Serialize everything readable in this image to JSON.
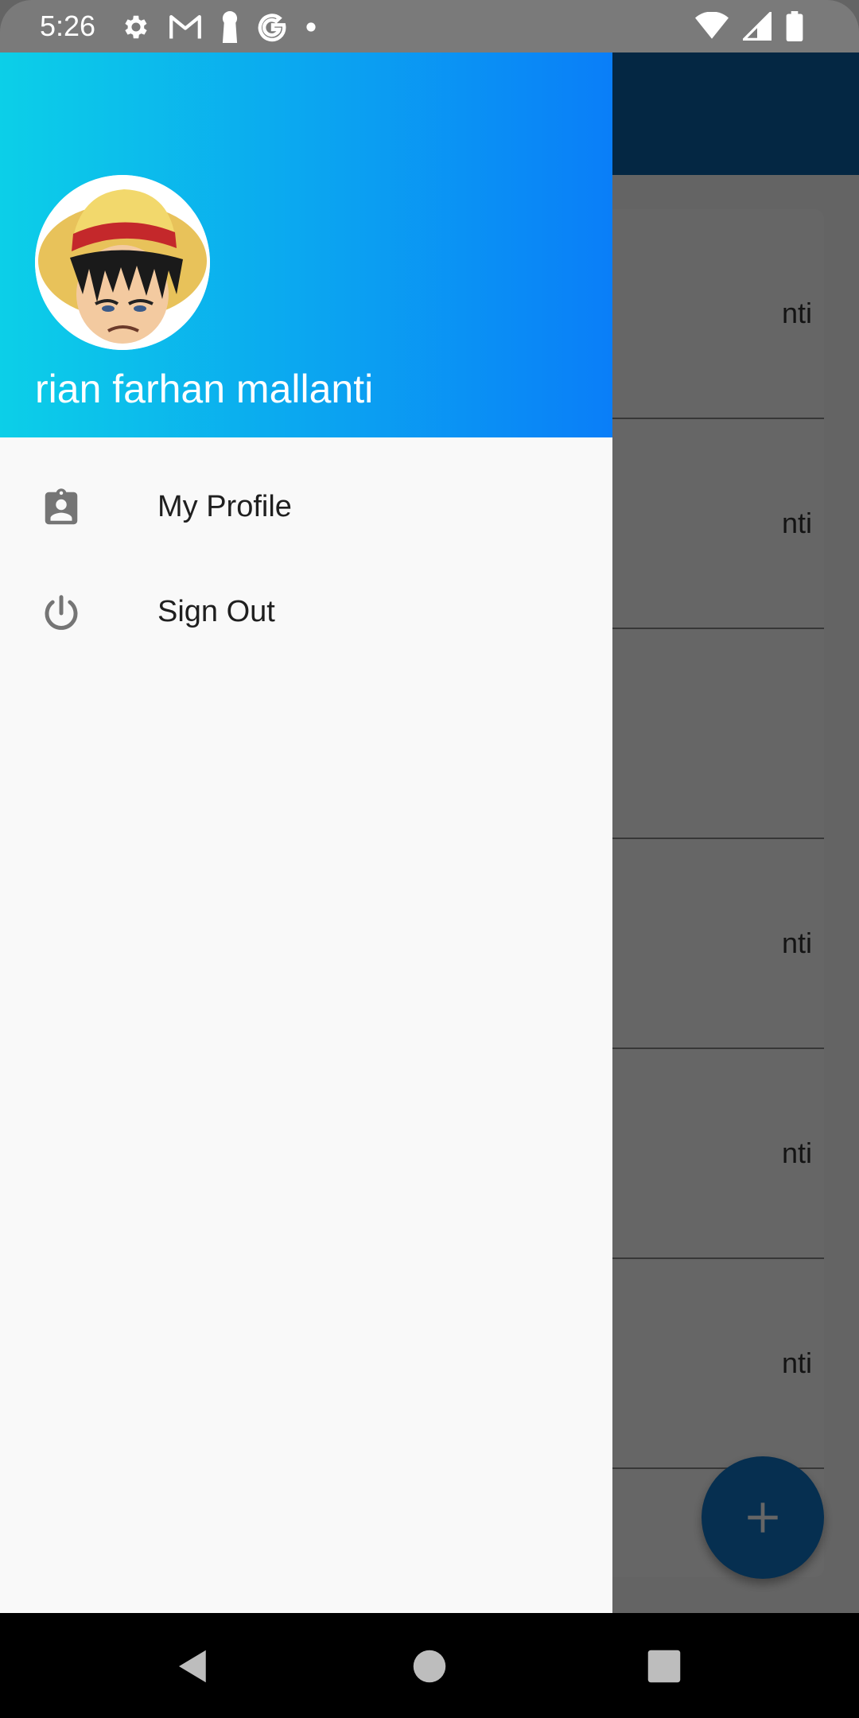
{
  "status_bar": {
    "time": "5:26",
    "left_icons": [
      "settings-icon",
      "gmail-icon",
      "keyhole-icon",
      "google-icon",
      "dot-icon"
    ],
    "right_icons": [
      "wifi-icon",
      "signal-icon",
      "battery-icon"
    ]
  },
  "background_app": {
    "row_partial_labels": [
      "nti",
      "nti",
      "",
      "nti",
      "nti",
      "nti"
    ],
    "fab_icon": "plus-icon",
    "colors": {
      "app_bar": "#0a63a8",
      "fab": "#1076c8"
    }
  },
  "drawer": {
    "header": {
      "user_name": "rian farhan mallanti",
      "avatar": "avatar-image",
      "gradient": [
        "#0ccfe8",
        "#0a7ef8"
      ]
    },
    "menu": [
      {
        "label": "My Profile",
        "icon": "profile-badge-icon"
      },
      {
        "label": "Sign Out",
        "icon": "power-icon"
      }
    ]
  },
  "nav_bar": {
    "buttons": [
      "back-icon",
      "home-icon",
      "recents-icon"
    ]
  }
}
